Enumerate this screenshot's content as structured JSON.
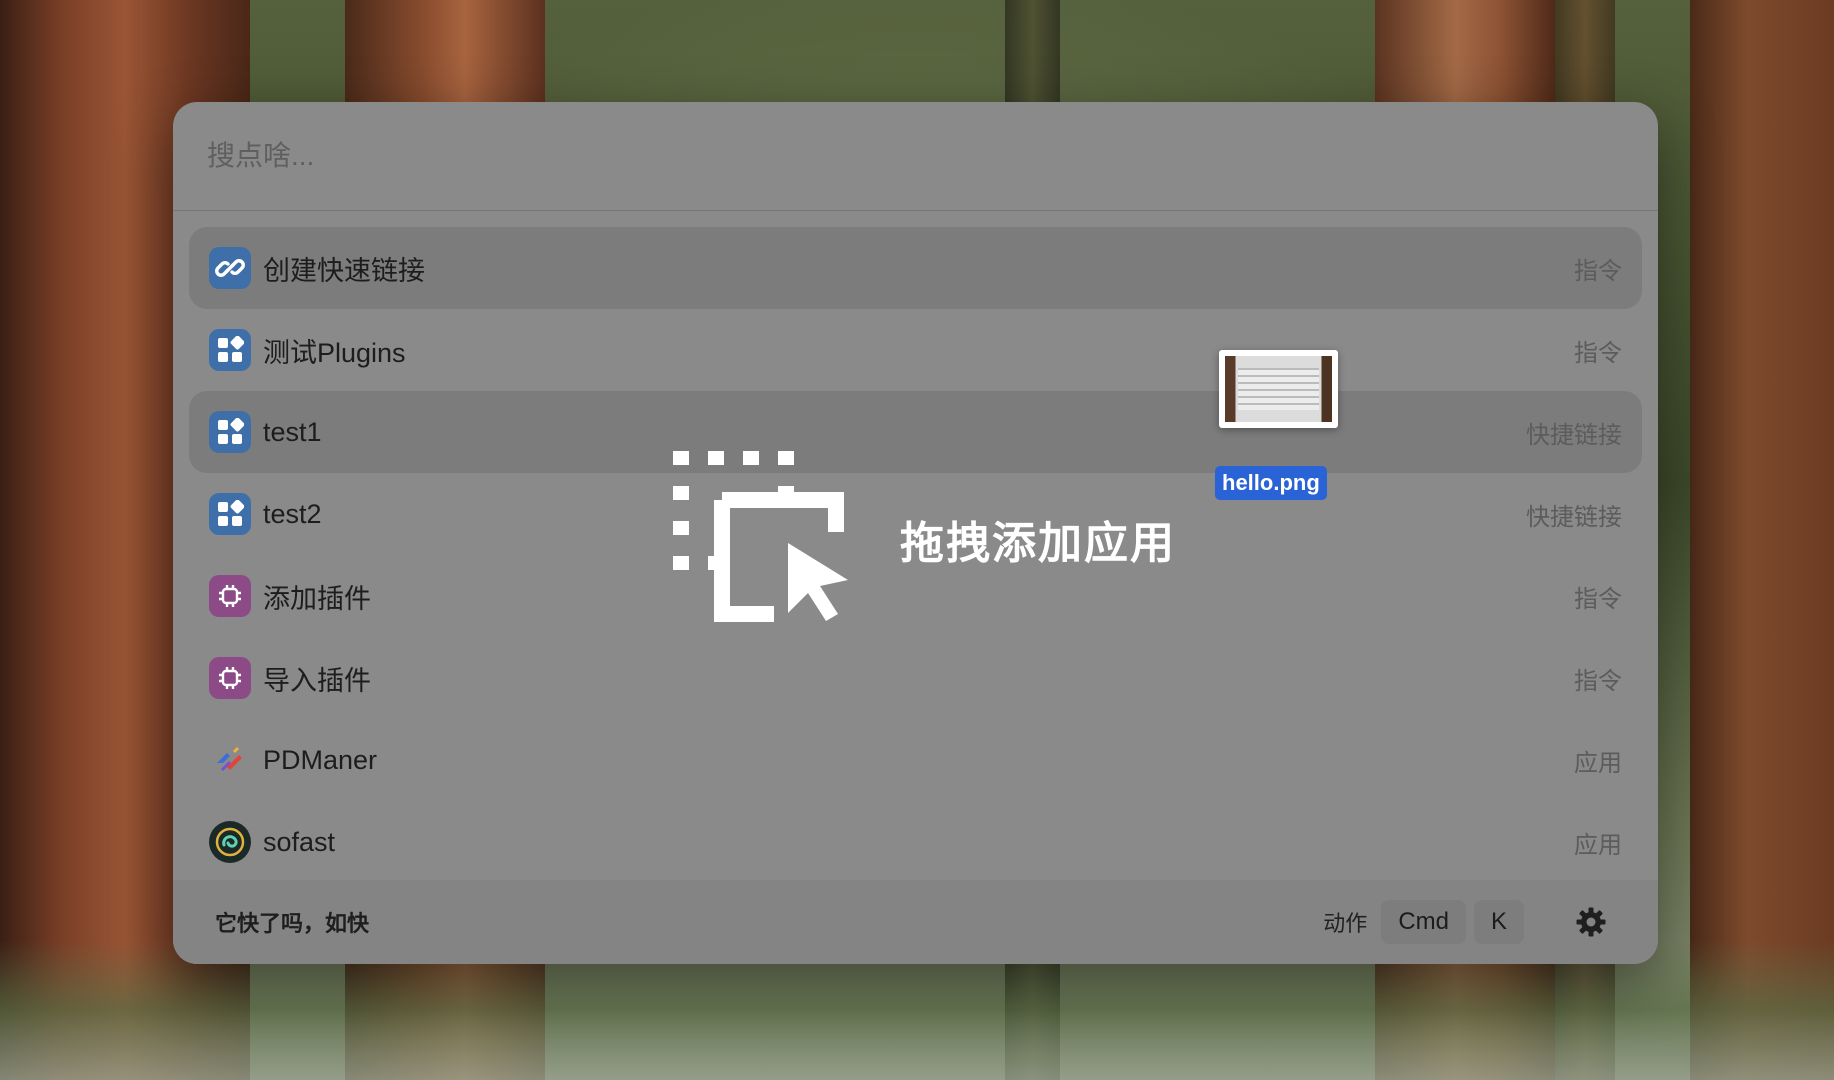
{
  "launcher": {
    "search": {
      "placeholder": "搜点啥..."
    },
    "items": [
      {
        "label": "创建快速链接",
        "type": "指令",
        "icon": "link-icon",
        "icon_color": "#3e6fa8"
      },
      {
        "label": "测试Plugins",
        "type": "指令",
        "icon": "plugin-grid-icon",
        "icon_color": "#3e6fa8"
      },
      {
        "label": "test1",
        "type": "快捷链接",
        "icon": "plugin-grid-icon",
        "icon_color": "#3e6fa8"
      },
      {
        "label": "test2",
        "type": "快捷链接",
        "icon": "plugin-grid-icon",
        "icon_color": "#3e6fa8"
      },
      {
        "label": "添加插件",
        "type": "指令",
        "icon": "chip-icon",
        "icon_color": "#8c4b86"
      },
      {
        "label": "导入插件",
        "type": "指令",
        "icon": "chip-icon",
        "icon_color": "#8c4b86"
      },
      {
        "label": "PDManer",
        "type": "应用",
        "icon": "pdmaner-app-icon"
      },
      {
        "label": "sofast",
        "type": "应用",
        "icon": "sofast-app-icon"
      }
    ],
    "drop_overlay": {
      "text": "拖拽添加应用",
      "icon": "drag-select-cursor-icon"
    },
    "footer": {
      "slogan": "它快了吗，如快",
      "action_label": "动作",
      "shortcut_keys": [
        "Cmd",
        "K"
      ],
      "settings_icon": "gear-icon"
    }
  },
  "dragged_file": {
    "name": "hello.png"
  }
}
